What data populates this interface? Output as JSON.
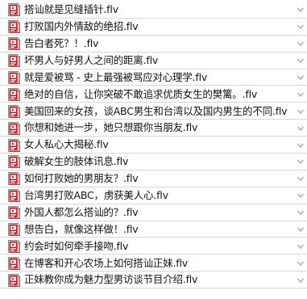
{
  "files": [
    {
      "name": "搭讪就是见缝插针.flv"
    },
    {
      "name": "打败国内外情敌的绝招.flv"
    },
    {
      "name": "告白者死？！.flv"
    },
    {
      "name": "坏男人与好男人之间的距离.flv"
    },
    {
      "name": "就是爱被骂 - 史上最强被骂应对心理学.flv"
    },
    {
      "name": "绝对的自信，让你突破不敢追求优质女生的樊篱。.flv"
    },
    {
      "name": "美国回来的女孩，谈ABC男生和台湾以及国内男生的不同.flv"
    },
    {
      "name": "你想和她进一步，她只想跟你当朋友.flv"
    },
    {
      "name": "女人私心大揭秘.flv"
    },
    {
      "name": "破解女生的肢体讯息.flv"
    },
    {
      "name": "如何打败她的男朋友？.flv"
    },
    {
      "name": "台湾男打败ABC，虏获美人心.flv"
    },
    {
      "name": "外国人都怎么搭讪的？.flv"
    },
    {
      "name": "想告白，就像这样做！.flv"
    },
    {
      "name": "约会时如何牵手接吻.flv"
    },
    {
      "name": "在博客和开心农场上如何搭讪正妹.flv"
    },
    {
      "name": "正妹教你成为魅力型男访谈节目介绍.flv"
    }
  ],
  "colors": {
    "icon_red": "#c8141e",
    "icon_dark": "#7a0a10",
    "arrow": "#9a9a9a"
  }
}
